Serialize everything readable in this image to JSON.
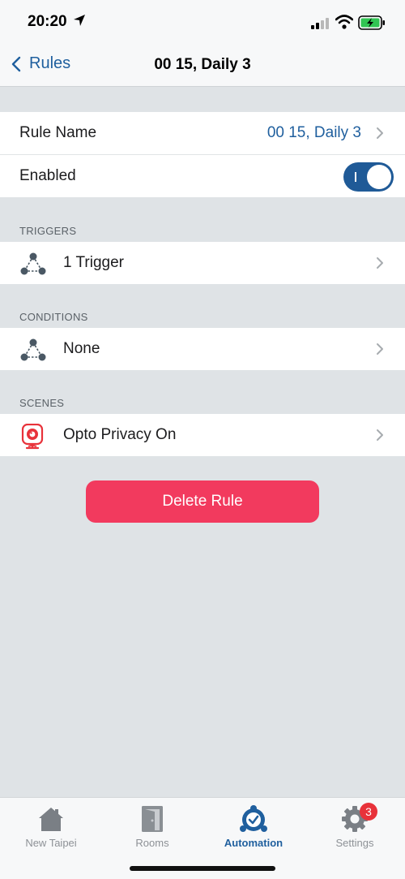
{
  "status_bar": {
    "time": "20:20"
  },
  "nav": {
    "back_label": "Rules",
    "title": "00 15, Daily 3"
  },
  "settings": {
    "rule_name_label": "Rule Name",
    "rule_name_value": "00 15, Daily 3",
    "enabled_label": "Enabled",
    "enabled": true
  },
  "sections": {
    "triggers": {
      "header": "TRIGGERS",
      "item_label": "1 Trigger",
      "icon": "triangle-nodes-icon"
    },
    "conditions": {
      "header": "CONDITIONS",
      "item_label": "None",
      "icon": "triangle-nodes-icon"
    },
    "scenes": {
      "header": "SCENES",
      "item_label": "Opto Privacy On",
      "icon": "camera-icon"
    }
  },
  "delete_button": "Delete Rule",
  "tabbar": {
    "tabs": [
      {
        "label": "New Taipei",
        "icon": "home-icon",
        "active": false
      },
      {
        "label": "Rooms",
        "icon": "door-icon",
        "active": false
      },
      {
        "label": "Automation",
        "icon": "automation-icon",
        "active": true
      },
      {
        "label": "Settings",
        "icon": "gear-icon",
        "active": false,
        "badge": "3"
      }
    ]
  },
  "colors": {
    "accent": "#1f5f9e",
    "delete": "#f23a5e",
    "background": "#dfe3e6",
    "badge": "#e8323a"
  }
}
